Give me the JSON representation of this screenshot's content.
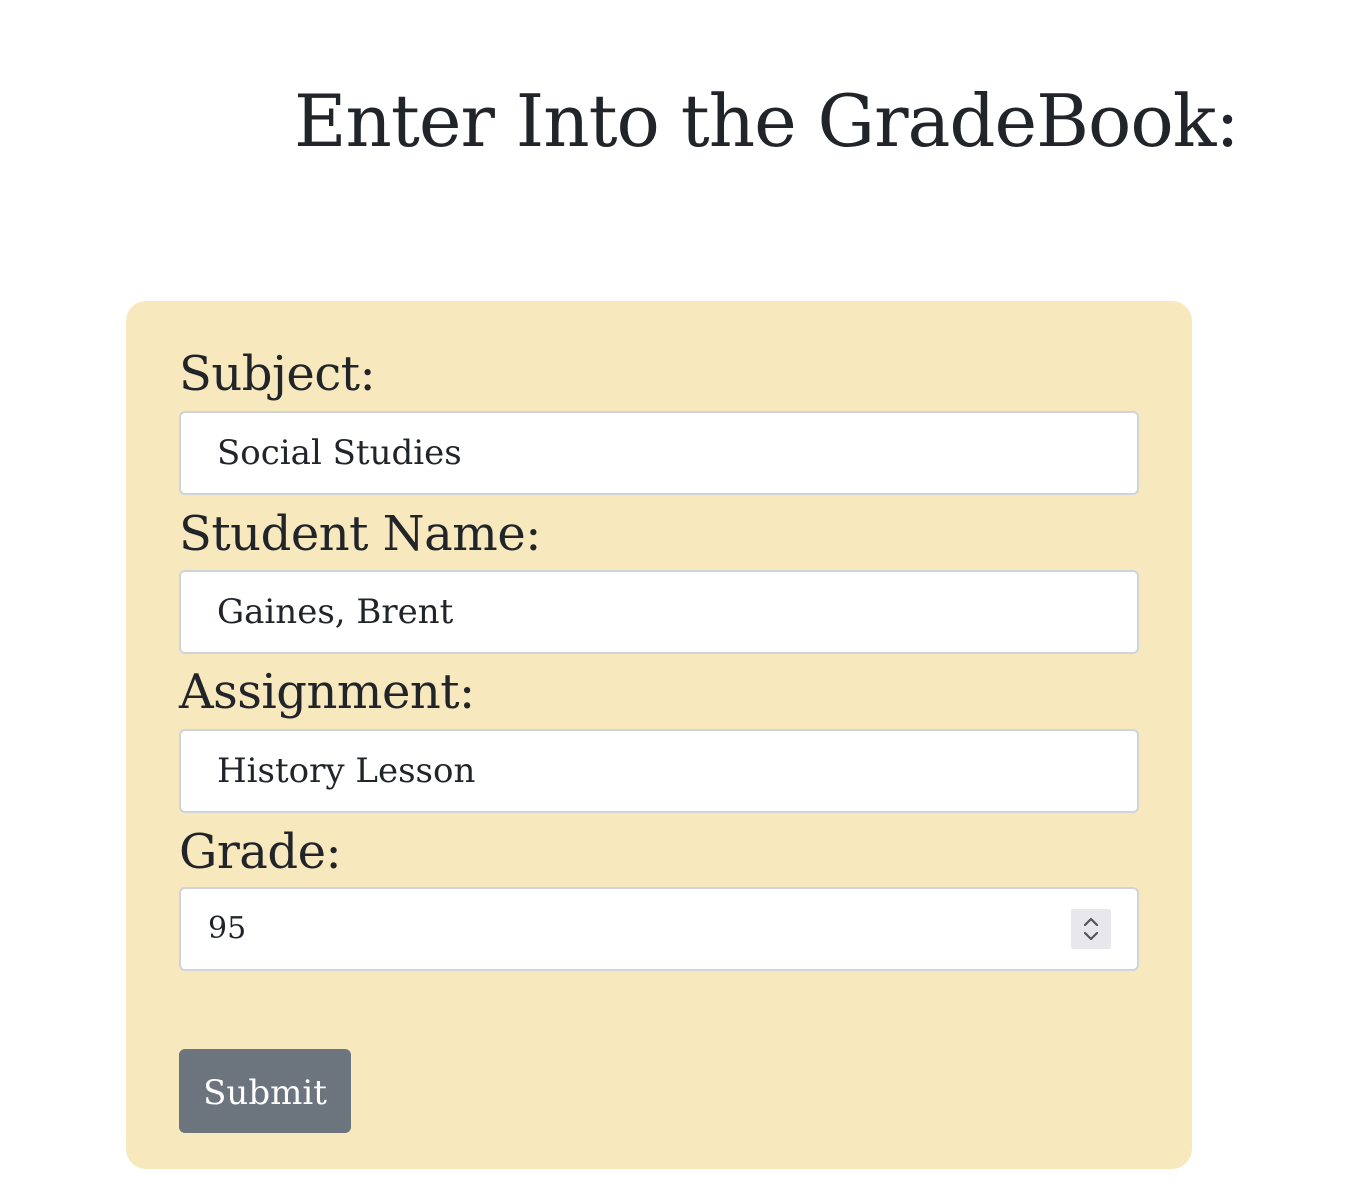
{
  "page": {
    "title": "Enter Into the GradeBook:"
  },
  "form": {
    "subject": {
      "label": "Subject:",
      "value": "Social Studies"
    },
    "student_name": {
      "label": "Student Name:",
      "value": "Gaines, Brent"
    },
    "assignment": {
      "label": "Assignment:",
      "value": "History Lesson"
    },
    "grade": {
      "label": "Grade:",
      "value": "95",
      "spinner_icon": "chevron-up-down-icon"
    },
    "submit_label": "Submit"
  },
  "colors": {
    "card_background": "#f7e9bd",
    "button_background": "#6c757d",
    "text": "#212529",
    "input_border": "#ced4da"
  }
}
